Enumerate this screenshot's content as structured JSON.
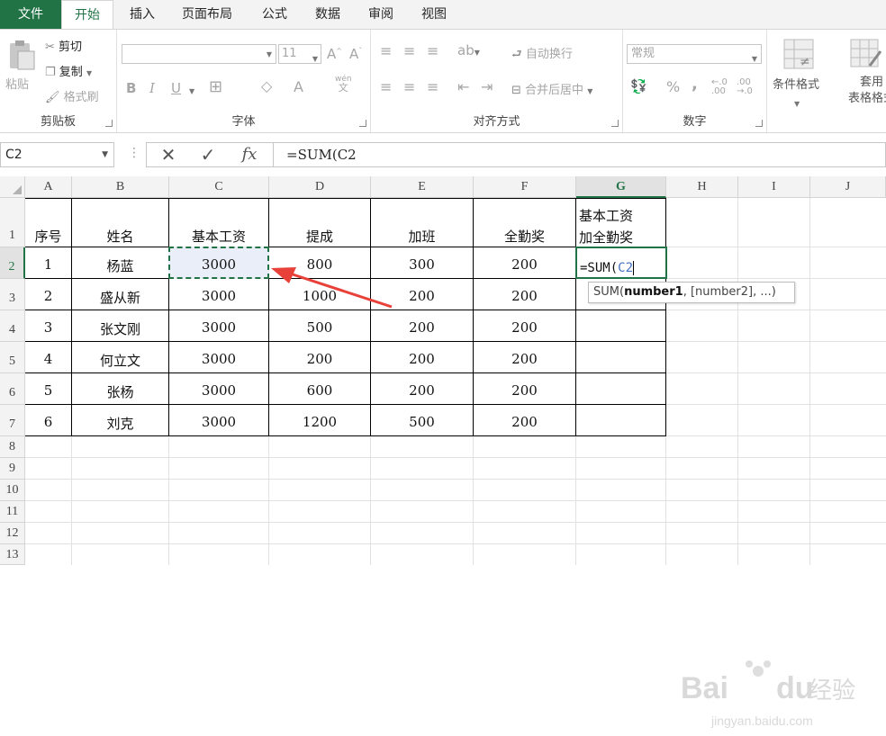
{
  "ribbon_tabs": [
    "文件",
    "开始",
    "插入",
    "页面布局",
    "公式",
    "数据",
    "审阅",
    "视图"
  ],
  "clipboard": {
    "paste": "粘贴",
    "cut": "剪切",
    "copy": "复制",
    "format_painter": "格式刷",
    "label": "剪贴板"
  },
  "font": {
    "size": "11",
    "label": "字体",
    "pinyin_top": "wén",
    "pinyin_bottom": "文"
  },
  "alignment": {
    "wrap": "自动换行",
    "merge": "合并后居中",
    "label": "对齐方式"
  },
  "number": {
    "format": "常规",
    "label": "数字",
    "percent": "%",
    "comma": ","
  },
  "styles": {
    "conditional": "条件格式",
    "table_format_1": "套用",
    "table_format_2": "表格格式"
  },
  "namebox": "C2",
  "formula": "=SUM(C2",
  "columns": [
    "A",
    "B",
    "C",
    "D",
    "E",
    "F",
    "G",
    "H",
    "I",
    "J"
  ],
  "rows": [
    "1",
    "2",
    "3",
    "4",
    "5",
    "6",
    "7",
    "8",
    "9",
    "10",
    "11",
    "12",
    "13"
  ],
  "table": {
    "headers": [
      "序号",
      "姓名",
      "基本工资",
      "提成",
      "加班",
      "全勤奖"
    ],
    "g_header_line1": "基本工资",
    "g_header_line2": "加全勤奖",
    "rows": [
      [
        "1",
        "杨蓝",
        "3000",
        "800",
        "300",
        "200"
      ],
      [
        "2",
        "盛从新",
        "3000",
        "1000",
        "200",
        "200"
      ],
      [
        "3",
        "张文刚",
        "3000",
        "500",
        "200",
        "200"
      ],
      [
        "4",
        "何立文",
        "3000",
        "200",
        "200",
        "200"
      ],
      [
        "5",
        "张杨",
        "3000",
        "600",
        "200",
        "200"
      ],
      [
        "6",
        "刘克",
        "3000",
        "1200",
        "500",
        "200"
      ]
    ]
  },
  "active_cell": {
    "prefix": "=SUM(",
    "ref": "C2"
  },
  "tooltip": {
    "func": "SUM(",
    "arg1": "number1",
    "rest": ", [number2], ...)"
  },
  "watermark": {
    "brand": "Bai",
    "brand2": "du",
    "cn": "经验",
    "url": "jingyan.baidu.com"
  },
  "colors": {
    "accent": "#217346",
    "ref_blue": "#4472c4",
    "arrow": "#e8413a"
  }
}
